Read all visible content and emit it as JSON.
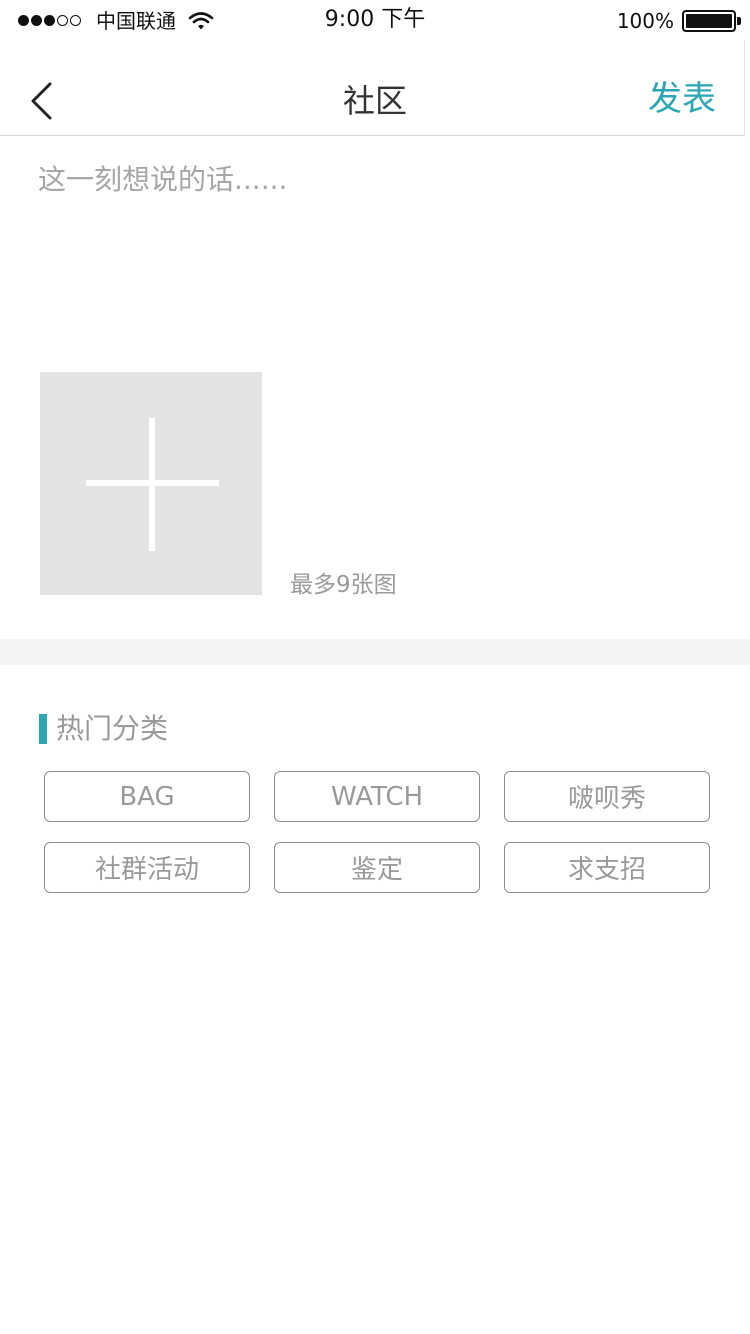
{
  "status_bar": {
    "carrier": "中国联通",
    "time": "9:00 下午",
    "battery": "100%",
    "signal_bars_filled": 3,
    "signal_bars_total": 5,
    "icons": [
      "signal-dots-icon",
      "wifi-icon",
      "battery-icon"
    ]
  },
  "nav": {
    "back_icon": "chevron-left-icon",
    "title": "社区",
    "publish_label": "发表"
  },
  "composer": {
    "placeholder": "这一刻想说的话......",
    "add_photo_icon": "plus-icon",
    "photo_hint": "最多9张图"
  },
  "categories": {
    "heading": "热门分类",
    "items": [
      {
        "label": "BAG"
      },
      {
        "label": "WATCH"
      },
      {
        "label": "啵呗秀"
      },
      {
        "label": "社群活动"
      },
      {
        "label": "鉴定"
      },
      {
        "label": "求支招"
      }
    ]
  },
  "colors": {
    "accent": "#2aa6b4",
    "placeholder_text": "#a6a6a6",
    "muted_text": "#9a9a9a",
    "photo_tile": "#e4e4e4",
    "section_gap": "#f5f5f5"
  }
}
